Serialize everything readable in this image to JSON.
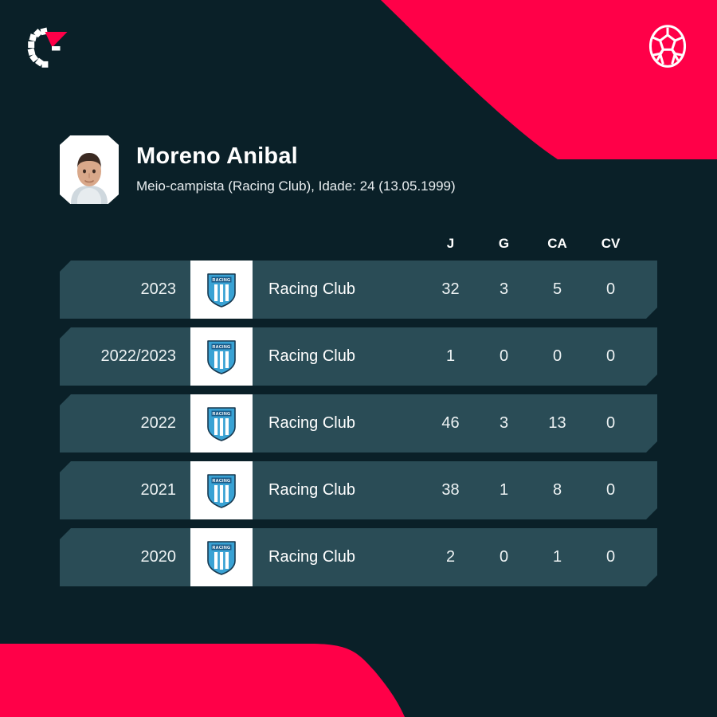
{
  "theme": {
    "background": "#0a2028",
    "accent_red": "#ff0048",
    "row_background": "#2a4c56",
    "text_primary": "#ffffff",
    "crest_blue": "#39a2d4",
    "crest_dark_blue": "#1b5c8a"
  },
  "header": {
    "brand_logo_icon": "flashscore-dial-logo-icon",
    "ball_icon": "soccer-ball-icon"
  },
  "player": {
    "avatar_icon": "player-headshot-avatar",
    "name": "Moreno Anibal",
    "meta": "Meio-campista (Racing Club), Idade: 24 (13.05.1999)"
  },
  "table": {
    "columns": [
      {
        "key": "J",
        "label": "J"
      },
      {
        "key": "G",
        "label": "G"
      },
      {
        "key": "CA",
        "label": "CA"
      },
      {
        "key": "CV",
        "label": "CV"
      }
    ],
    "rows": [
      {
        "season": "2023",
        "crest_icon": "racing-club-crest-icon",
        "club": "Racing Club",
        "J": "32",
        "G": "3",
        "CA": "5",
        "CV": "0"
      },
      {
        "season": "2022/2023",
        "crest_icon": "racing-club-crest-icon",
        "club": "Racing Club",
        "J": "1",
        "G": "0",
        "CA": "0",
        "CV": "0"
      },
      {
        "season": "2022",
        "crest_icon": "racing-club-crest-icon",
        "club": "Racing Club",
        "J": "46",
        "G": "3",
        "CA": "13",
        "CV": "0"
      },
      {
        "season": "2021",
        "crest_icon": "racing-club-crest-icon",
        "club": "Racing Club",
        "J": "38",
        "G": "1",
        "CA": "8",
        "CV": "0"
      },
      {
        "season": "2020",
        "crest_icon": "racing-club-crest-icon",
        "club": "Racing Club",
        "J": "2",
        "G": "0",
        "CA": "1",
        "CV": "0"
      }
    ]
  },
  "crest": {
    "text": "RACING"
  }
}
